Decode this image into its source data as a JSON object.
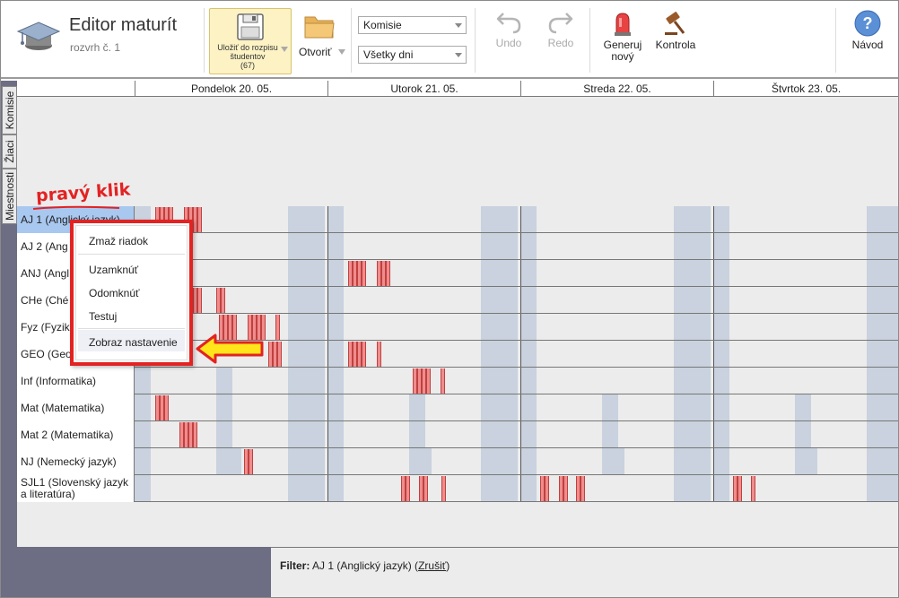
{
  "app": {
    "title": "Editor maturít",
    "subtitle": "rozvrh č. 1"
  },
  "toolbar": {
    "save_label_line1": "Uložiť do rozpisu",
    "save_label_line2": "študentov",
    "save_count": "(67)",
    "open_label": "Otvoriť",
    "select_view": "Komisie",
    "select_days": "Všetky dni",
    "undo_label": "Undo",
    "redo_label": "Redo",
    "generate_label_line1": "Generuj",
    "generate_label_line2": "nový",
    "check_label": "Kontrola",
    "help_label": "Návod"
  },
  "sidebar": {
    "tabs": [
      "Komisie",
      "Žiaci",
      "Miestnosti"
    ]
  },
  "days": [
    "Pondelok 20. 05.",
    "Utorok 21. 05.",
    "Streda 22. 05.",
    "Štvrtok 23. 05."
  ],
  "rows": [
    {
      "label": "AJ 1 (Anglický jazyk)",
      "visible_label": "AJ 1 (Anglický jazyk)",
      "selected": true
    },
    {
      "label": "AJ 2 (Ang"
    },
    {
      "label": "ANJ (Angl"
    },
    {
      "label": "CHe (Ché"
    },
    {
      "label": "Fyz (Fyzik"
    },
    {
      "label": "GEO (Geo"
    },
    {
      "label": "Inf (Informatika)"
    },
    {
      "label": "Mat (Matematika)"
    },
    {
      "label": "Mat 2 (Matematika)"
    },
    {
      "label": "NJ (Nemecký jazyk)"
    },
    {
      "label": "SJL1 (Slovenský jazyk a literatúra)"
    }
  ],
  "context_menu": {
    "items": [
      "Zmaž riadok",
      "Uzamknúť",
      "Odomknúť",
      "Testuj",
      "Zobraz nastavenie"
    ],
    "highlighted": "Zobraz nastavenie"
  },
  "annotation": {
    "text": "pravý klik"
  },
  "filter": {
    "label": "Filter:",
    "value": "AJ 1 (Anglický jazyk)",
    "cancel": "Zrušiť"
  },
  "colors": {
    "accent": "#e32222",
    "event": "#f08c8c",
    "slot": "#c9d2de",
    "selected_row": "#a9c8f0",
    "sidebar": "#6d6d84",
    "arrow": "#ffe51a"
  }
}
